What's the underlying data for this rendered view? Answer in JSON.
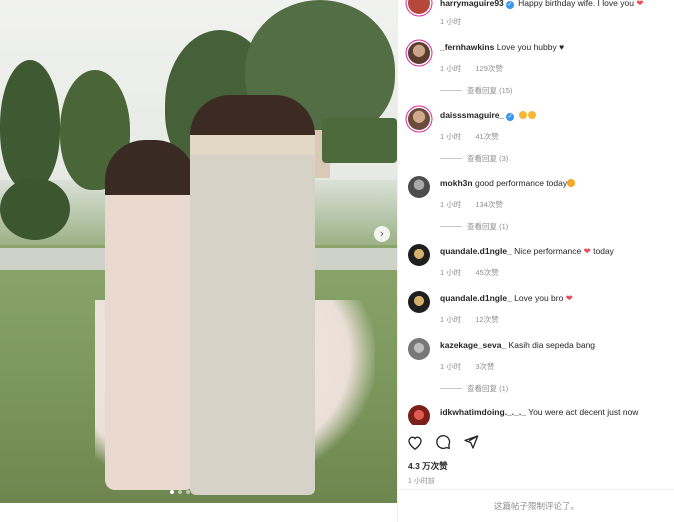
{
  "post": {
    "image_alt_hint": "wedding-photo",
    "likes": "4.3 万次赞",
    "time_ago": "1 小时前",
    "comments_closed": "这篇帖子限制评论了。"
  },
  "comments": [
    {
      "user": "harrymaguire93",
      "verified": true,
      "text": "Happy birthday wife. I love you",
      "emoji_after": "heart",
      "time": "1 小时",
      "likes": "",
      "replies": ""
    },
    {
      "user": "_fernhawkins",
      "verified": false,
      "text": "Love you hubby ♥",
      "emoji_after": "",
      "time": "1 小时",
      "likes": "129次赞",
      "replies": "查看回复 (15)"
    },
    {
      "user": "daisssmaguire_",
      "verified": true,
      "text": "",
      "emoji_after": "heart-eyes-x2",
      "time": "1 小时",
      "likes": "41次赞",
      "replies": "查看回复 (3)"
    },
    {
      "user": "mokh3n",
      "verified": false,
      "text": "good performance today",
      "emoji_after": "clap",
      "time": "1 小时",
      "likes": "134次赞",
      "replies": "查看回复 (1)"
    },
    {
      "user": "quandale.d1ngle_",
      "verified": false,
      "text": "Nice performance",
      "emoji_after": "heart",
      "text_after": "today",
      "time": "1 小时",
      "likes": "45次赞",
      "replies": ""
    },
    {
      "user": "quandale.d1ngle_",
      "verified": false,
      "text": "Love you bro",
      "emoji_after": "heart",
      "time": "1 小时",
      "likes": "12次赞",
      "replies": ""
    },
    {
      "user": "kazekage_seva_",
      "verified": false,
      "text": "Kasih dia sepeda bang",
      "emoji_after": "",
      "time": "1 小时",
      "likes": "3次赞",
      "replies": "查看回复 (1)"
    },
    {
      "user": "idkwhatimdoing._._._",
      "verified": false,
      "text": "You were act decent just now",
      "emoji_after": "",
      "time": "",
      "likes": "",
      "replies": ""
    }
  ],
  "colors": {
    "heart": "#ed4956",
    "verified": "#3897f0",
    "meta": "#8e8e8e",
    "ring": "#d6249f"
  },
  "icons": [
    "like-icon",
    "comment-icon",
    "share-icon",
    "next-photo-icon"
  ]
}
